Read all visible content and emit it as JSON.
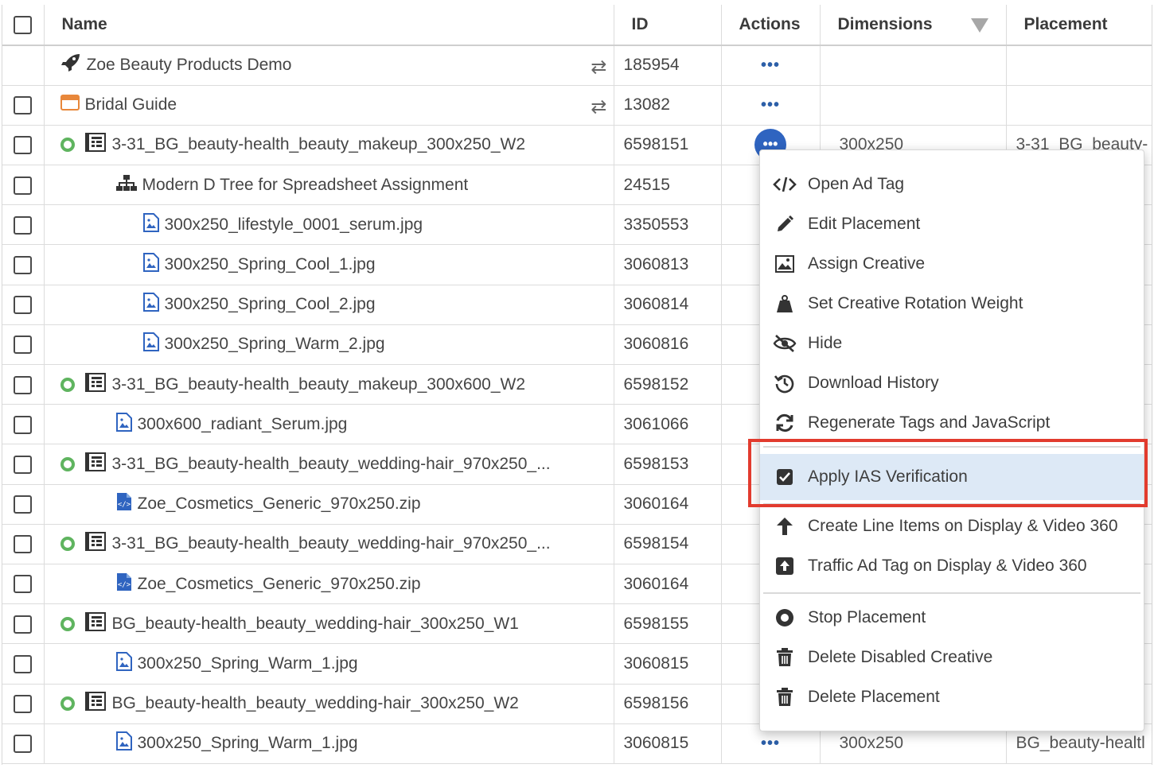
{
  "table": {
    "headers": {
      "name": "Name",
      "id": "ID",
      "actions": "Actions",
      "dimensions": "Dimensions",
      "placement": "Placement"
    },
    "rows": [
      {
        "name": "Zoe Beauty Products Demo",
        "id": "185954",
        "dims": "",
        "placement": "",
        "icon": "rocket-icon"
      },
      {
        "name": "Bridal Guide",
        "id": "13082",
        "dims": "",
        "placement": "",
        "icon": "window-icon"
      },
      {
        "name": "3-31_BG_beauty-health_beauty_makeup_300x250_W2",
        "id": "6598151",
        "dims": "300x250",
        "placement": "3-31_BG_beauty-",
        "icon": "placement-icon"
      },
      {
        "name": "Modern D Tree for Spreadsheet Assignment",
        "id": "24515",
        "dims": "",
        "placement": "",
        "icon": "tree-icon"
      },
      {
        "name": "300x250_lifestyle_0001_serum.jpg",
        "id": "3350553",
        "dims": "",
        "placement": "",
        "icon": "image-file-icon"
      },
      {
        "name": "300x250_Spring_Cool_1.jpg",
        "id": "3060813",
        "dims": "",
        "placement": "",
        "icon": "image-file-icon"
      },
      {
        "name": "300x250_Spring_Cool_2.jpg",
        "id": "3060814",
        "dims": "",
        "placement": "",
        "icon": "image-file-icon"
      },
      {
        "name": "300x250_Spring_Warm_2.jpg",
        "id": "3060816",
        "dims": "",
        "placement": "",
        "icon": "image-file-icon"
      },
      {
        "name": "3-31_BG_beauty-health_beauty_makeup_300x600_W2",
        "id": "6598152",
        "dims": "",
        "placement": "",
        "icon": "placement-icon"
      },
      {
        "name": "300x600_radiant_Serum.jpg",
        "id": "3061066",
        "dims": "",
        "placement": "",
        "icon": "image-file-icon"
      },
      {
        "name": "3-31_BG_beauty-health_beauty_wedding-hair_970x250_...",
        "id": "6598153",
        "dims": "",
        "placement": "",
        "icon": "placement-icon"
      },
      {
        "name": "Zoe_Cosmetics_Generic_970x250.zip",
        "id": "3060164",
        "dims": "",
        "placement": "",
        "icon": "code-file-icon"
      },
      {
        "name": "3-31_BG_beauty-health_beauty_wedding-hair_970x250_...",
        "id": "6598154",
        "dims": "",
        "placement": "",
        "icon": "placement-icon"
      },
      {
        "name": "Zoe_Cosmetics_Generic_970x250.zip",
        "id": "3060164",
        "dims": "",
        "placement": "",
        "icon": "code-file-icon"
      },
      {
        "name": "BG_beauty-health_beauty_wedding-hair_300x250_W1",
        "id": "6598155",
        "dims": "",
        "placement": "",
        "icon": "placement-icon"
      },
      {
        "name": "300x250_Spring_Warm_1.jpg",
        "id": "3060815",
        "dims": "",
        "placement": "",
        "icon": "image-file-icon"
      },
      {
        "name": "BG_beauty-health_beauty_wedding-hair_300x250_W2",
        "id": "6598156",
        "dims": "",
        "placement": "",
        "icon": "placement-icon"
      },
      {
        "name": "300x250_Spring_Warm_1.jpg",
        "id": "3060815",
        "dims": "300x250",
        "placement": "BG_beauty-healtl",
        "icon": "image-file-icon"
      }
    ],
    "actions_glyph": "•••"
  },
  "menu": {
    "items": [
      {
        "label": "Open Ad Tag",
        "icon": "code-icon"
      },
      {
        "label": "Edit Placement",
        "icon": "pencil-icon"
      },
      {
        "label": "Assign Creative",
        "icon": "image-icon"
      },
      {
        "label": "Set Creative Rotation Weight",
        "icon": "weight-icon"
      },
      {
        "label": "Hide",
        "icon": "eye-slash-icon"
      },
      {
        "label": "Download History",
        "icon": "history-icon"
      },
      {
        "label": "Regenerate Tags and JavaScript",
        "icon": "refresh-icon"
      },
      {
        "label": "Apply IAS Verification",
        "icon": "checkbox-checked-icon"
      },
      {
        "label": "Create Line Items on Display & Video 360",
        "icon": "arrow-up-icon"
      },
      {
        "label": "Traffic Ad Tag on Display & Video 360",
        "icon": "upload-square-icon"
      },
      {
        "label": "Stop Placement",
        "icon": "stop-circle-icon"
      },
      {
        "label": "Delete Disabled Creative",
        "icon": "trash-icon"
      },
      {
        "label": "Delete Placement",
        "icon": "trash-icon"
      }
    ],
    "highlighted_index": 7
  },
  "colors": {
    "accent": "#2f64c0",
    "status_green": "#5fb45f",
    "highlight_box": "#e23b2e",
    "menu_hover": "#dde9f6"
  }
}
